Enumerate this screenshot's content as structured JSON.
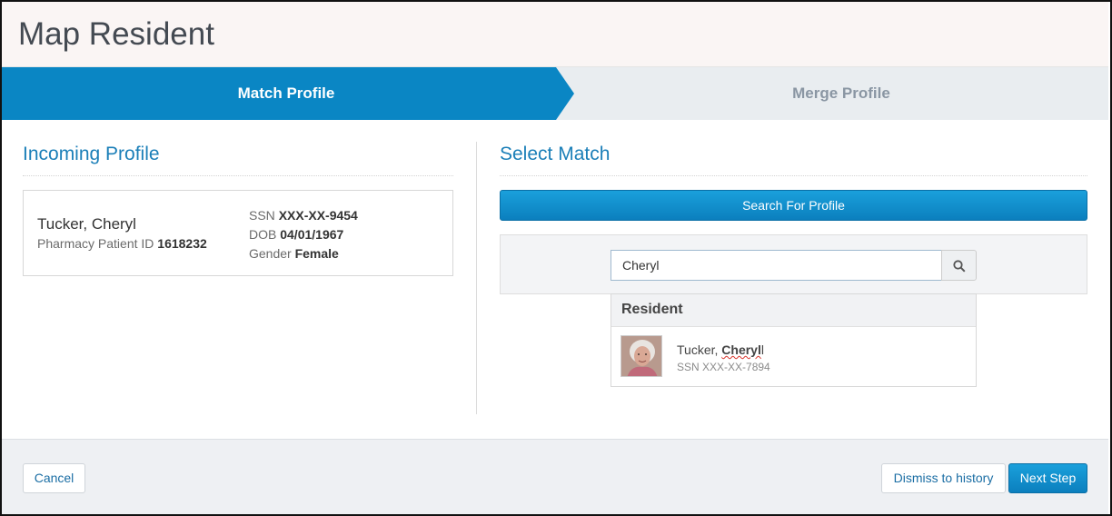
{
  "header": {
    "title": "Map Resident"
  },
  "steps": [
    {
      "label": "Match Profile",
      "active": true
    },
    {
      "label": "Merge Profile",
      "active": false
    }
  ],
  "incoming": {
    "section_title": "Incoming Profile",
    "name": "Tucker, Cheryl",
    "patient_id_label": "Pharmacy Patient ID",
    "patient_id": "1618232",
    "ssn_label": "SSN",
    "ssn": "XXX-XX-9454",
    "dob_label": "DOB",
    "dob": "04/01/1967",
    "gender_label": "Gender",
    "gender": "Female"
  },
  "match": {
    "section_title": "Select Match",
    "search_button": "Search For Profile",
    "search_value": "Cheryl",
    "results_header": "Resident",
    "results": [
      {
        "name_prefix": "Tucker, ",
        "name_highlight": "Cheryl",
        "name_suffix": "l",
        "ssn": "SSN XXX-XX-7894"
      }
    ]
  },
  "footer": {
    "cancel": "Cancel",
    "dismiss": "Dismiss to history",
    "next": "Next Step"
  },
  "colors": {
    "accent": "#0a86c4",
    "title_blue": "#1b7fb8",
    "step_bg": "#e9edf0"
  }
}
